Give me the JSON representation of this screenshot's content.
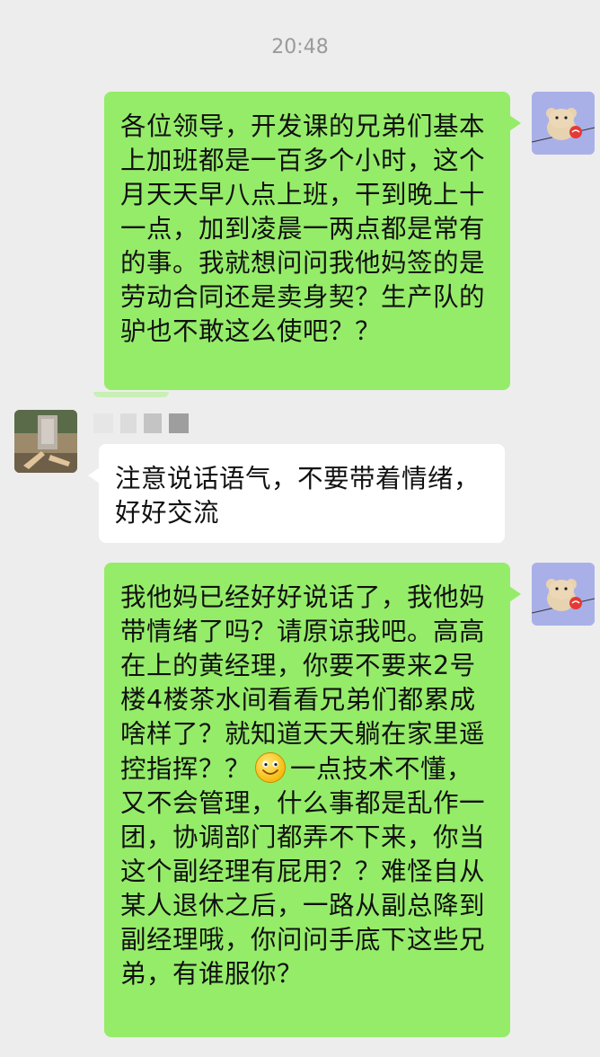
{
  "chat": {
    "timestamp": "20:48",
    "messages": [
      {
        "direction": "outgoing",
        "text": "各位领导，开发课的兄弟们基本上加班都是一百多个小时，这个月天天早八点上班，干到晚上十一点，加到凌晨一两点都是常有的事。我就想问问我他妈签的是劳动合同还是卖身契？生产队的驴也不敢这么使吧？？"
      },
      {
        "direction": "incoming",
        "text": "注意说话语气，不要带着情绪，好好交流"
      },
      {
        "direction": "outgoing",
        "text_before_emoji": "我他妈已经好好说话了，我他妈带情绪了吗？请原谅我吧。高高在上的黄经理，你要不要来2号楼4楼茶水间看看兄弟们都累成啥样了？就知道天天躺在家里遥控指挥？？",
        "emoji": "smile-emoji",
        "text_after_emoji": "一点技术不懂，又不会管理，什么事都是乱作一团，协调部门都弄不下来，你当这个副经理有屁用？？难怪自从某人退休之后，一路从副总降到副经理哦，你问问手底下这些兄弟，有谁服你？"
      }
    ]
  },
  "colors": {
    "background": "#ededed",
    "outgoing_bubble": "#95ec69",
    "incoming_bubble": "#ffffff",
    "timestamp_text": "#9a9a9a"
  }
}
